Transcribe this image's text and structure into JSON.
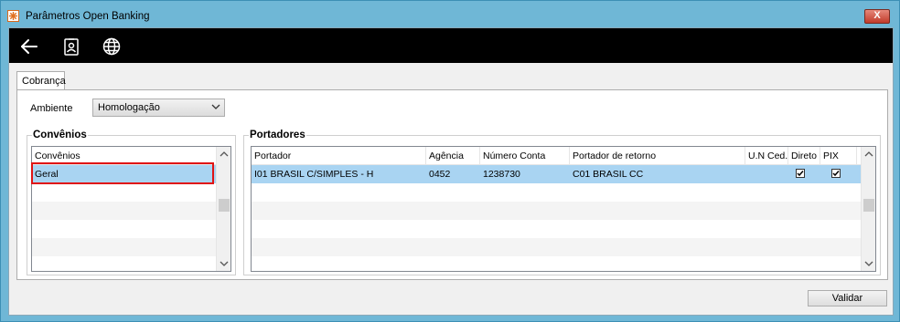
{
  "window": {
    "title": "Parâmetros Open Banking",
    "close_label": "X"
  },
  "toolbar": {
    "items": [
      {
        "icon": "back-arrow-icon"
      },
      {
        "icon": "id-badge-icon"
      },
      {
        "icon": "globe-icon"
      }
    ]
  },
  "tabs": [
    {
      "label": "Cobrança",
      "active": true
    }
  ],
  "ambiente": {
    "label": "Ambiente",
    "value": "Homologação"
  },
  "convenios": {
    "title": "Convênios",
    "header": "Convênios",
    "rows": [
      "Geral"
    ],
    "selected_row": "Geral"
  },
  "portadores": {
    "title": "Portadores",
    "columns": [
      "Portador",
      "Agência",
      "Número Conta",
      "Portador de retorno",
      "U.N Ced.",
      "Direto",
      "PIX"
    ],
    "rows": [
      {
        "portador": "I01  BRASIL C/SIMPLES - H",
        "agencia": "0452",
        "numero_conta": "1238730",
        "portador_retorno": "C01  BRASIL CC",
        "un_ced": "",
        "direto": true,
        "pix": true
      }
    ]
  },
  "actions": {
    "validar_label": "Validar"
  },
  "colors": {
    "title_bar": "#6fb7d6",
    "toolbar": "#000000",
    "selected_row": "#a9d4f2",
    "highlight_border": "#e01414"
  }
}
